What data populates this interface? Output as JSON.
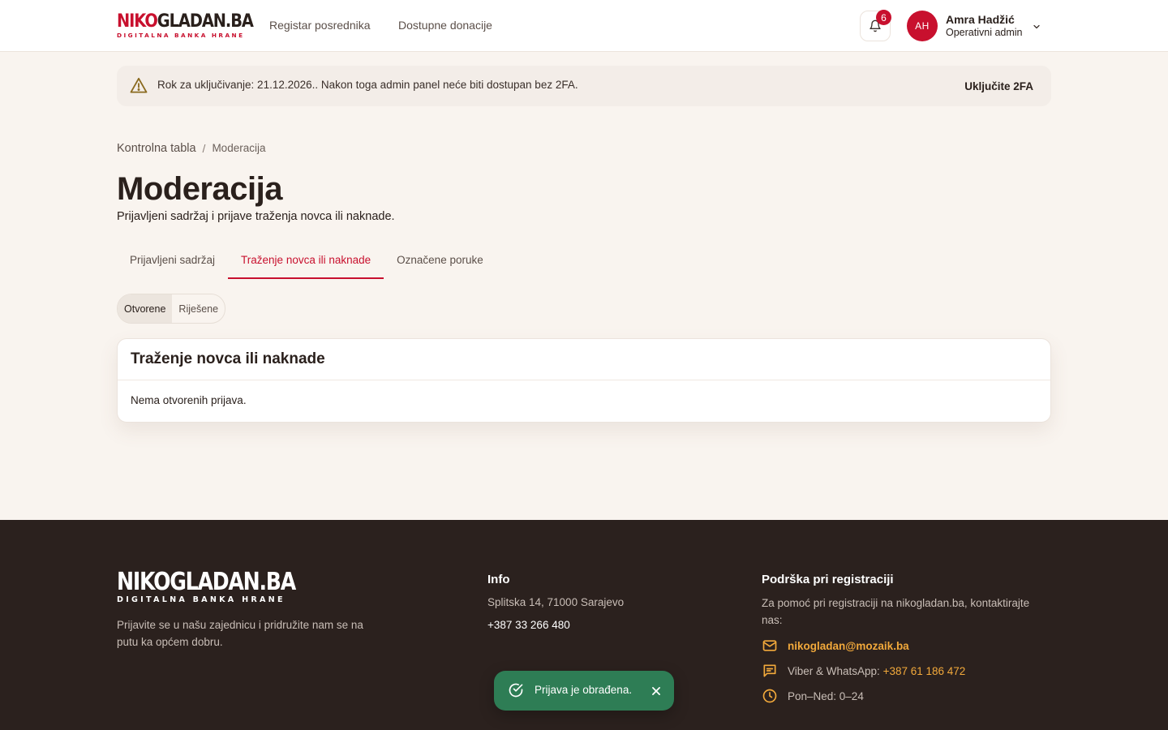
{
  "brand": {
    "logo_part1": "NIKO",
    "logo_part2": "GLADAN.BA",
    "tagline": "DIGITALNA BANKA HRANE",
    "accent_color": "#c8102e"
  },
  "nav": {
    "items": [
      {
        "label": "Registar posrednika"
      },
      {
        "label": "Dostupne donacije"
      }
    ]
  },
  "notifications": {
    "icon": "bell-icon",
    "count": "6"
  },
  "user": {
    "initials": "AH",
    "name": "Amra Hadžić",
    "role": "Operativni admin",
    "menu_icon": "chevron-down-icon"
  },
  "banner": {
    "icon": "warning-icon",
    "text": "Rok za uključivanje: 21.12.2026.. Nakon toga admin panel neće biti dostupan bez 2FA.",
    "action_label": "Uključite 2FA"
  },
  "breadcrumb": {
    "home": "Kontrolna tabla",
    "separator": "/",
    "current": "Moderacija"
  },
  "page": {
    "title": "Moderacija",
    "subtitle": "Prijavljeni sadržaj i prijave traženja novca ili naknade."
  },
  "tabs": [
    {
      "label": "Prijavljeni sadržaj",
      "active": false
    },
    {
      "label": "Traženje novca ili naknade",
      "active": true
    },
    {
      "label": "Označene poruke",
      "active": false
    }
  ],
  "status_filter": {
    "options": [
      {
        "label": "Otvorene",
        "active": true
      },
      {
        "label": "Riješene",
        "active": false
      }
    ]
  },
  "card": {
    "title": "Traženje novca ili naknade",
    "empty_text": "Nema otvorenih prijava."
  },
  "footer": {
    "logo_text": "NIKOGLADAN.BA",
    "tagline": "DIGITALNA BANKA HRANE",
    "description": "Prijavite se u našu zajednicu i pridružite nam se na putu ka općem dobru.",
    "info": {
      "heading": "Info",
      "address": "Splitska 14, 71000 Sarajevo",
      "phone": "+387 33 266 480"
    },
    "support": {
      "heading": "Podrška pri registraciji",
      "description": "Za pomoć pri registraciji na nikogladan.ba, kontaktirajte nas:",
      "email": "nikogladan@mozaik.ba",
      "messaging_label": "Viber & WhatsApp:",
      "messaging_phone": "+387 61 186 472",
      "hours": "Pon–Ned: 0–24",
      "link_color": "#f2a93b"
    }
  },
  "toast": {
    "icon": "check-circle-icon",
    "text": "Prijava je obrađena.",
    "close_icon": "close-icon",
    "color": "#2e7d55"
  }
}
